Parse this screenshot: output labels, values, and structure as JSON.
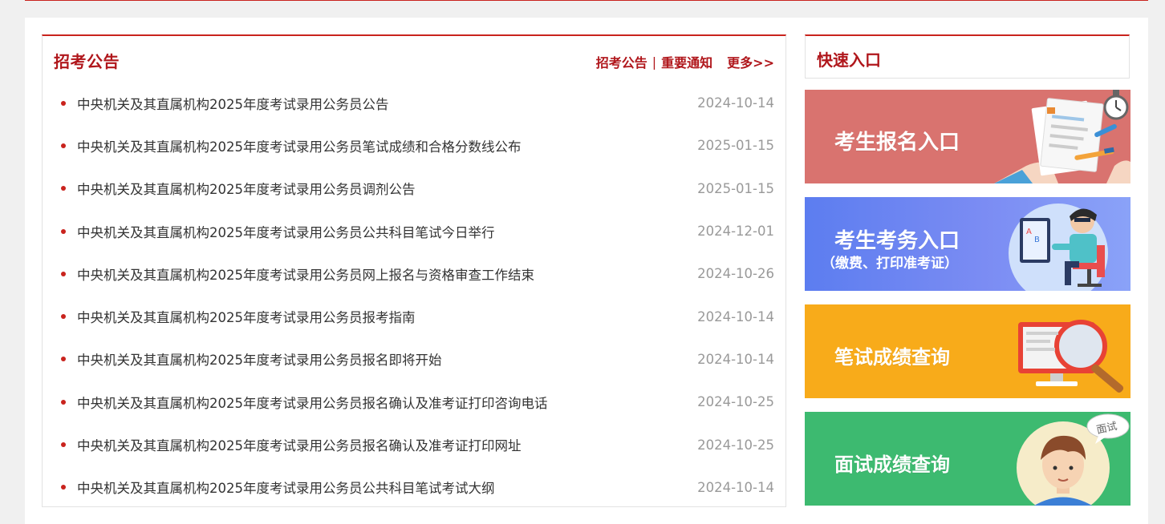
{
  "notices": {
    "title": "招考公告",
    "links": {
      "notice": "招考公告",
      "separator": "|",
      "important": "重要通知",
      "more": "更多>>"
    },
    "items": [
      {
        "title": "中央机关及其直属机构2025年度考试录用公务员公告",
        "date": "2024-10-14"
      },
      {
        "title": "中央机关及其直属机构2025年度考试录用公务员笔试成绩和合格分数线公布",
        "date": "2025-01-15"
      },
      {
        "title": "中央机关及其直属机构2025年度考试录用公务员调剂公告",
        "date": "2025-01-15"
      },
      {
        "title": "中央机关及其直属机构2025年度考试录用公务员公共科目笔试今日举行",
        "date": "2024-12-01"
      },
      {
        "title": "中央机关及其直属机构2025年度考试录用公务员网上报名与资格审查工作结束",
        "date": "2024-10-26"
      },
      {
        "title": "中央机关及其直属机构2025年度考试录用公务员报考指南",
        "date": "2024-10-14"
      },
      {
        "title": "中央机关及其直属机构2025年度考试录用公务员报名即将开始",
        "date": "2024-10-14"
      },
      {
        "title": "中央机关及其直属机构2025年度考试录用公务员报名确认及准考证打印咨询电话",
        "date": "2024-10-25"
      },
      {
        "title": "中央机关及其直属机构2025年度考试录用公务员报名确认及准考证打印网址",
        "date": "2024-10-25"
      },
      {
        "title": "中央机关及其直属机构2025年度考试录用公务员公共科目笔试考试大纲",
        "date": "2024-10-14"
      }
    ]
  },
  "quick": {
    "title": "快速入口",
    "cards": [
      {
        "label": "考生报名入口",
        "color": "#d9736f",
        "icon": "application-form-icon"
      },
      {
        "label": "考生考务入口",
        "sublabel": "（缴费、打印准考证）",
        "color": "#6c85f2",
        "icon": "student-at-computer-icon"
      },
      {
        "label": "笔试成绩查询",
        "color": "#f8ab1a",
        "icon": "monitor-magnifier-icon"
      },
      {
        "label": "面试成绩查询",
        "color": "#3dba70",
        "icon": "interview-person-icon",
        "badge": "面试"
      }
    ]
  },
  "colors": {
    "accent": "#c9231d",
    "title": "#b0161b",
    "date": "#999999"
  }
}
